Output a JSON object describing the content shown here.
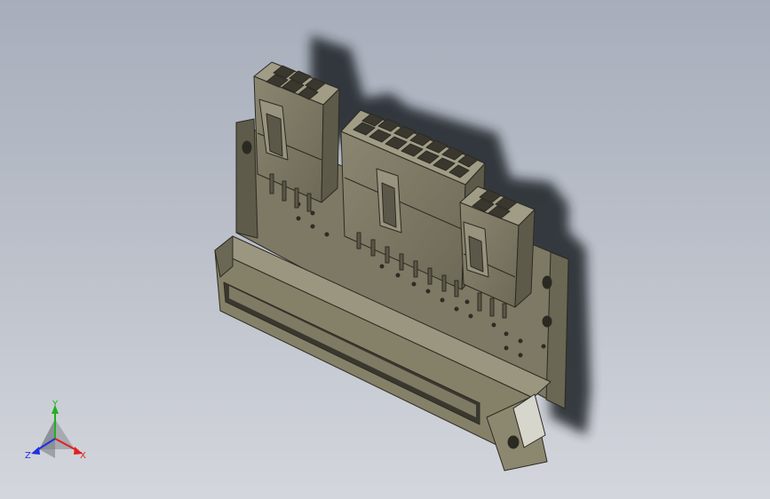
{
  "view": {
    "background_top": "#a7aebb",
    "background_bottom": "#d3d6dc",
    "part_color": "#77735f",
    "part_dark": "#4d4a3d",
    "part_light": "#97937e",
    "shadow_color": "#1e2028"
  },
  "triad": {
    "x_label": "X",
    "y_label": "Y",
    "z_label": "Z",
    "x_color": "#e02020",
    "y_color": "#20b020",
    "z_color": "#2030e0"
  },
  "model": {
    "icon": "connector-assembly-icon",
    "header_small_rows": 2,
    "header_small_cols": 2,
    "header_large_rows": 2,
    "header_large_cols": 7,
    "header_right_rows": 2,
    "header_right_cols": 2
  }
}
